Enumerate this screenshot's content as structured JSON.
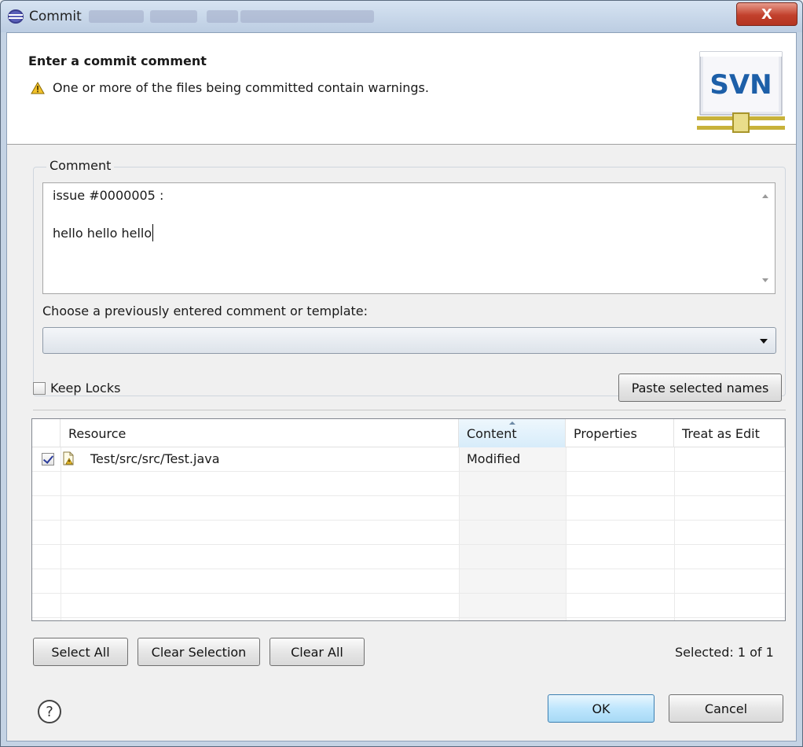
{
  "window": {
    "title": "Commit",
    "close_label": "X"
  },
  "banner": {
    "title": "Enter a commit comment",
    "message": "One or more of the files being committed contain warnings.",
    "logo_text": "SVN"
  },
  "comment": {
    "legend": "Comment",
    "lines": [
      "issue #0000005 :",
      "",
      "hello hello hello"
    ],
    "choose_label": "Choose a previously entered comment or template:",
    "template_selected": ""
  },
  "options": {
    "keep_locks_label": "Keep Locks",
    "keep_locks_checked": false,
    "paste_names_label": "Paste selected names"
  },
  "table": {
    "columns": [
      "Resource",
      "Content",
      "Properties",
      "Treat as Edit"
    ],
    "sorted_column": "Content",
    "rows": [
      {
        "checked": true,
        "resource": "Test/src/src/Test.java",
        "content": "Modified",
        "properties": "",
        "treat_as_edit": ""
      }
    ]
  },
  "selection_buttons": {
    "select_all": "Select All",
    "clear_selection": "Clear Selection",
    "clear_all": "Clear All"
  },
  "selected_count": "Selected: 1 of 1",
  "footer": {
    "ok_label": "OK",
    "cancel_label": "Cancel"
  },
  "icons": [
    "eclipse-app-icon",
    "warning-icon",
    "svn-logo",
    "file-warning-icon",
    "help-icon"
  ]
}
